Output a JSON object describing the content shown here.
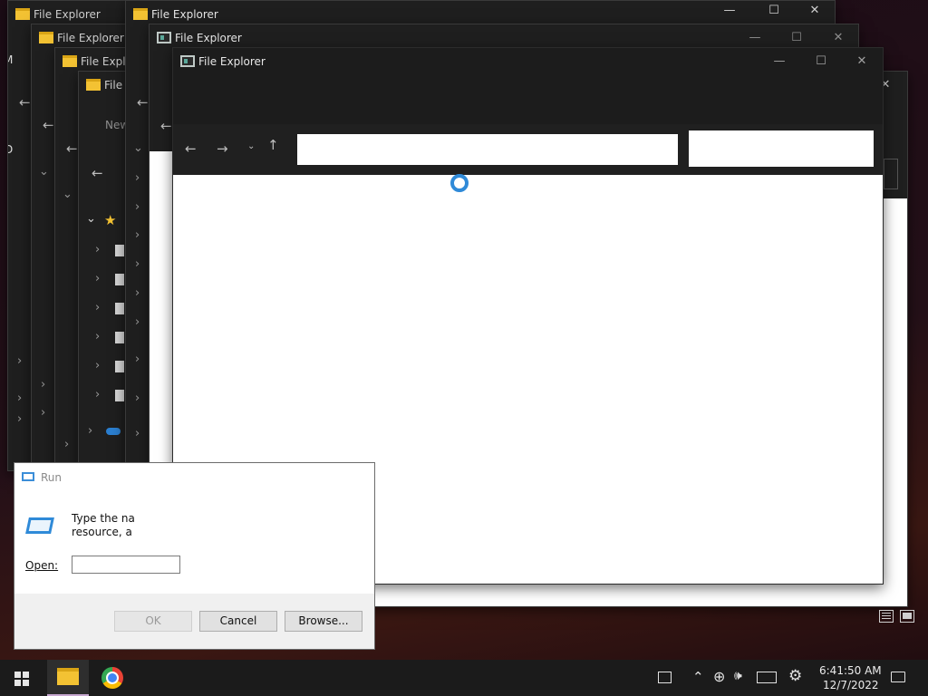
{
  "windows": {
    "title": "File Explorer",
    "title_truncated_1": "File Explo",
    "title_truncated_2": "File E",
    "partial_new": "New",
    "partial_letter_m": "M",
    "partial_letter_d": "D"
  },
  "run_dialog": {
    "title": "Run",
    "message_line1": "Type the na",
    "message_line2": "resource, a",
    "open_label": "Open:",
    "open_value": "",
    "ok_label": "OK",
    "cancel_label": "Cancel",
    "browse_label": "Browse..."
  },
  "taskbar": {
    "time": "6:41:50 AM",
    "date": "12/7/2022"
  },
  "colors": {
    "accent_loading": "#2f8ad8",
    "folder": "#f3c233",
    "window_dark": "#1f1f1f"
  },
  "icons": [
    "folder-icon",
    "screen-icon",
    "run-icon",
    "windows-start-icon",
    "chrome-icon",
    "chevron-up-icon",
    "globe-icon",
    "speaker-icon",
    "keyboard-icon",
    "gear-icon",
    "notification-icon",
    "star-icon",
    "onedrive-icon"
  ]
}
